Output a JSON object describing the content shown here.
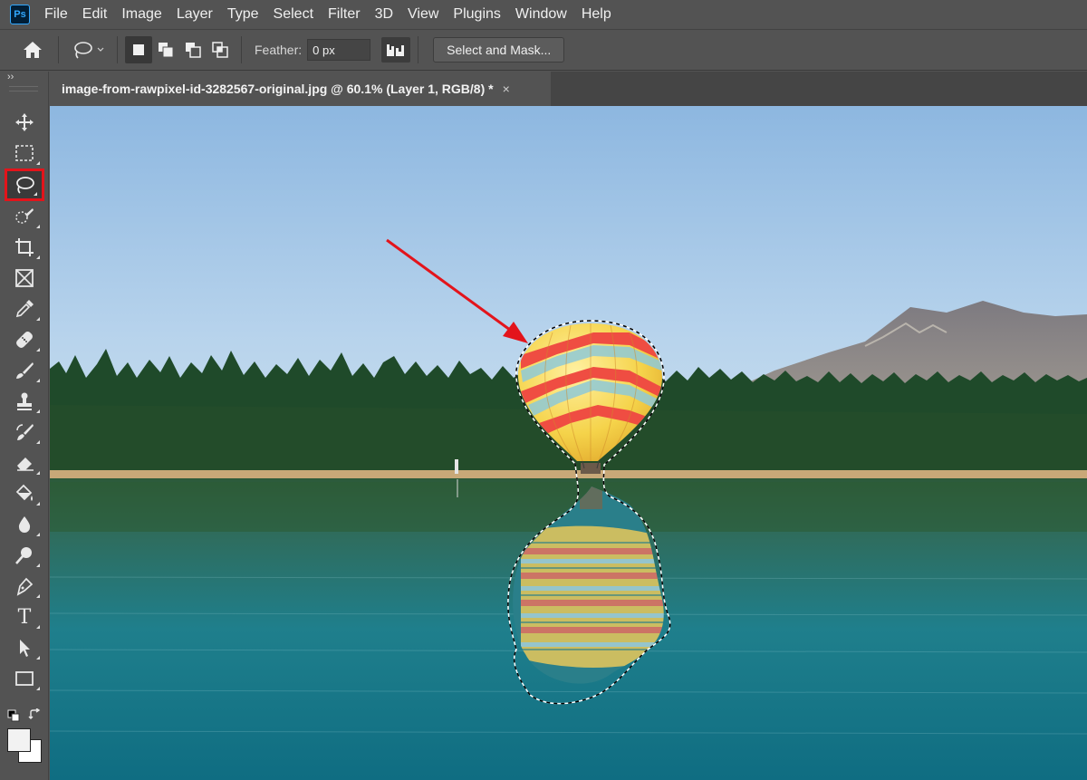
{
  "app": {
    "logo_text": "Ps"
  },
  "menu": [
    "File",
    "Edit",
    "Image",
    "Layer",
    "Type",
    "Select",
    "Filter",
    "3D",
    "View",
    "Plugins",
    "Window",
    "Help"
  ],
  "options": {
    "feather_label": "Feather:",
    "feather_value": "0 px",
    "select_mask_label": "Select and Mask..."
  },
  "document": {
    "tab_title": "image-from-rawpixel-id-3282567-original.jpg @ 60.1% (Layer 1, RGB/8) *",
    "close_glyph": "×"
  },
  "toolbar": {
    "collapse_glyph": "››",
    "type_tool_glyph": "T",
    "selected_tool": "lasso-tool"
  },
  "colors": {
    "highlight": "#e3141b",
    "arrow": "#e3141b",
    "foreground_swatch": "#f2f2f2",
    "background_swatch": "#ffffff"
  }
}
